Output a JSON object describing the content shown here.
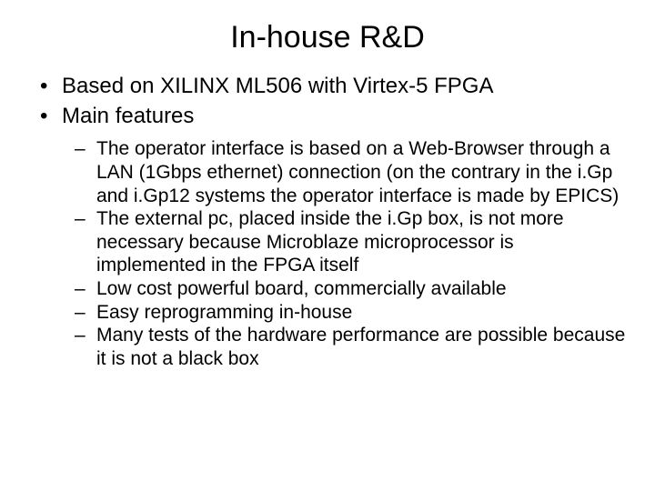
{
  "title": "In-house R&D",
  "bullets": {
    "b0": "Based on XILINX ML506 with Virtex-5 FPGA",
    "b1": "Main features"
  },
  "sub": {
    "s0": "The operator interface is based on a Web-Browser through a LAN (1Gbps ethernet) connection (on the contrary in the i.Gp and i.Gp12 systems the operator interface is made by EPICS)",
    "s1": "The external pc, placed inside the i.Gp box, is not more necessary because Microblaze microprocessor is implemented in the FPGA itself",
    "s2": "Low cost powerful board, commercially available",
    "s3": "Easy reprogramming in-house",
    "s4": "Many tests of the hardware performance are possible because it is not a black box"
  }
}
